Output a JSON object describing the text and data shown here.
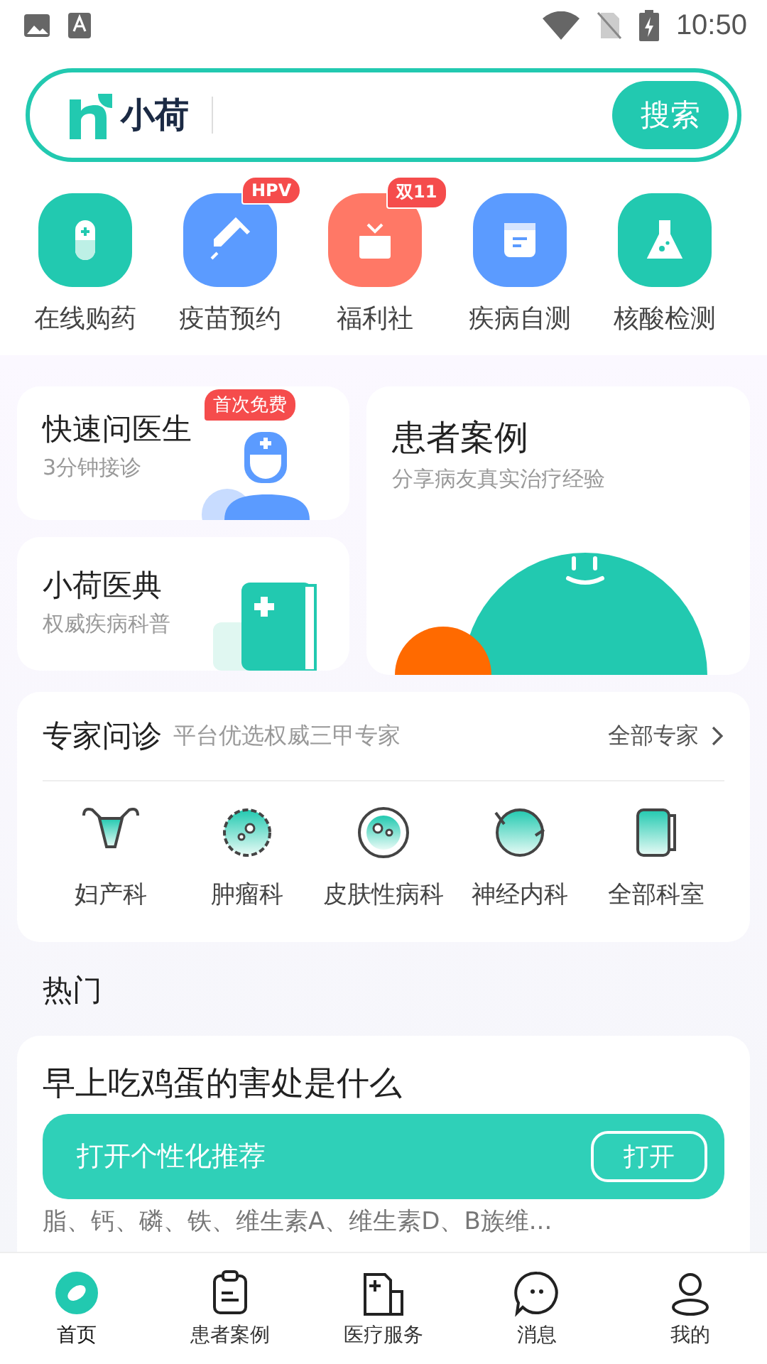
{
  "status_bar": {
    "time": "10:50"
  },
  "search": {
    "logo_text": "小荷",
    "button": "搜索"
  },
  "quick_actions": [
    {
      "label": "在线购药",
      "color": "#22c9b0"
    },
    {
      "label": "疫苗预约",
      "color": "#5b9bff",
      "badge": "HPV"
    },
    {
      "label": "福利社",
      "color": "#ff7866",
      "badge": "双11"
    },
    {
      "label": "疾病自测",
      "color": "#5b9bff"
    },
    {
      "label": "核酸检测",
      "color": "#22c9b0"
    }
  ],
  "feature_cards": {
    "ask_doctor": {
      "title": "快速问医生",
      "subtitle": "3分钟接诊",
      "badge": "首次免费"
    },
    "encyclopedia": {
      "title": "小荷医典",
      "subtitle": "权威疾病科普"
    },
    "cases": {
      "title": "患者案例",
      "subtitle": "分享病友真实治疗经验"
    }
  },
  "experts": {
    "title": "专家问诊",
    "subtitle": "平台优选权威三甲专家",
    "more": "全部专家",
    "departments": [
      "妇产科",
      "肿瘤科",
      "皮肤性病科",
      "神经内科",
      "全部科室"
    ]
  },
  "hot": {
    "title": "热门",
    "article": {
      "title": "早上吃鸡蛋的害处是什么",
      "excerpt_tail": "脂、钙、磷、铁、维生素A、维生素D、B族维..."
    }
  },
  "toast": {
    "text": "打开个性化推荐",
    "button": "打开"
  },
  "tabs": [
    {
      "label": "首页",
      "selected": true
    },
    {
      "label": "患者案例",
      "selected": false
    },
    {
      "label": "医疗服务",
      "selected": false
    },
    {
      "label": "消息",
      "selected": false
    },
    {
      "label": "我的",
      "selected": false
    }
  ]
}
